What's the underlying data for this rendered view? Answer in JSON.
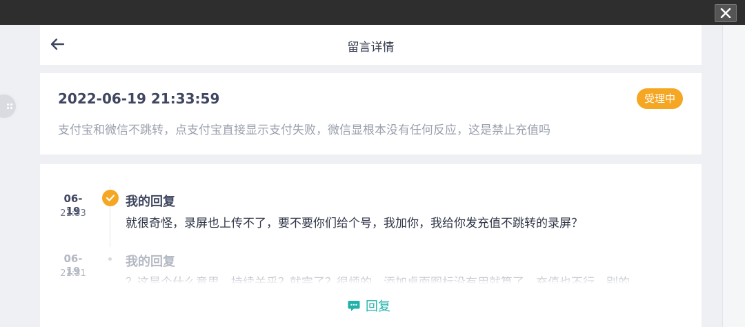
{
  "window": {
    "close_label": "close"
  },
  "header": {
    "title": "留言详情"
  },
  "message": {
    "datetime": "2022-06-19 21:33:59",
    "status": "受理中",
    "content": "支付宝和微信不跳转，点支付宝直接显示支付失败，微信显根本没有任何反应，这是禁止充值吗"
  },
  "replies": [
    {
      "date": "06-19",
      "time": "21:33",
      "author": "我的回复",
      "text": "就很奇怪，录屏也上传不了，要不要你们给个号，我加你，我给你发充值不跳转的录屏？"
    },
    {
      "date": "06-19",
      "time": "21:31",
      "author": "我的回复",
      "text": "？这是个什么意思，持续关乎？就完了？很烦的，添加桌面图标没有用就算了，充值也不行，别的"
    }
  ],
  "actions": {
    "reply_label": "回复"
  },
  "colors": {
    "accent": "#f5a623",
    "reply": "#20b2aa",
    "text_dark": "#3f4660",
    "text_muted": "#9aa0ad"
  }
}
